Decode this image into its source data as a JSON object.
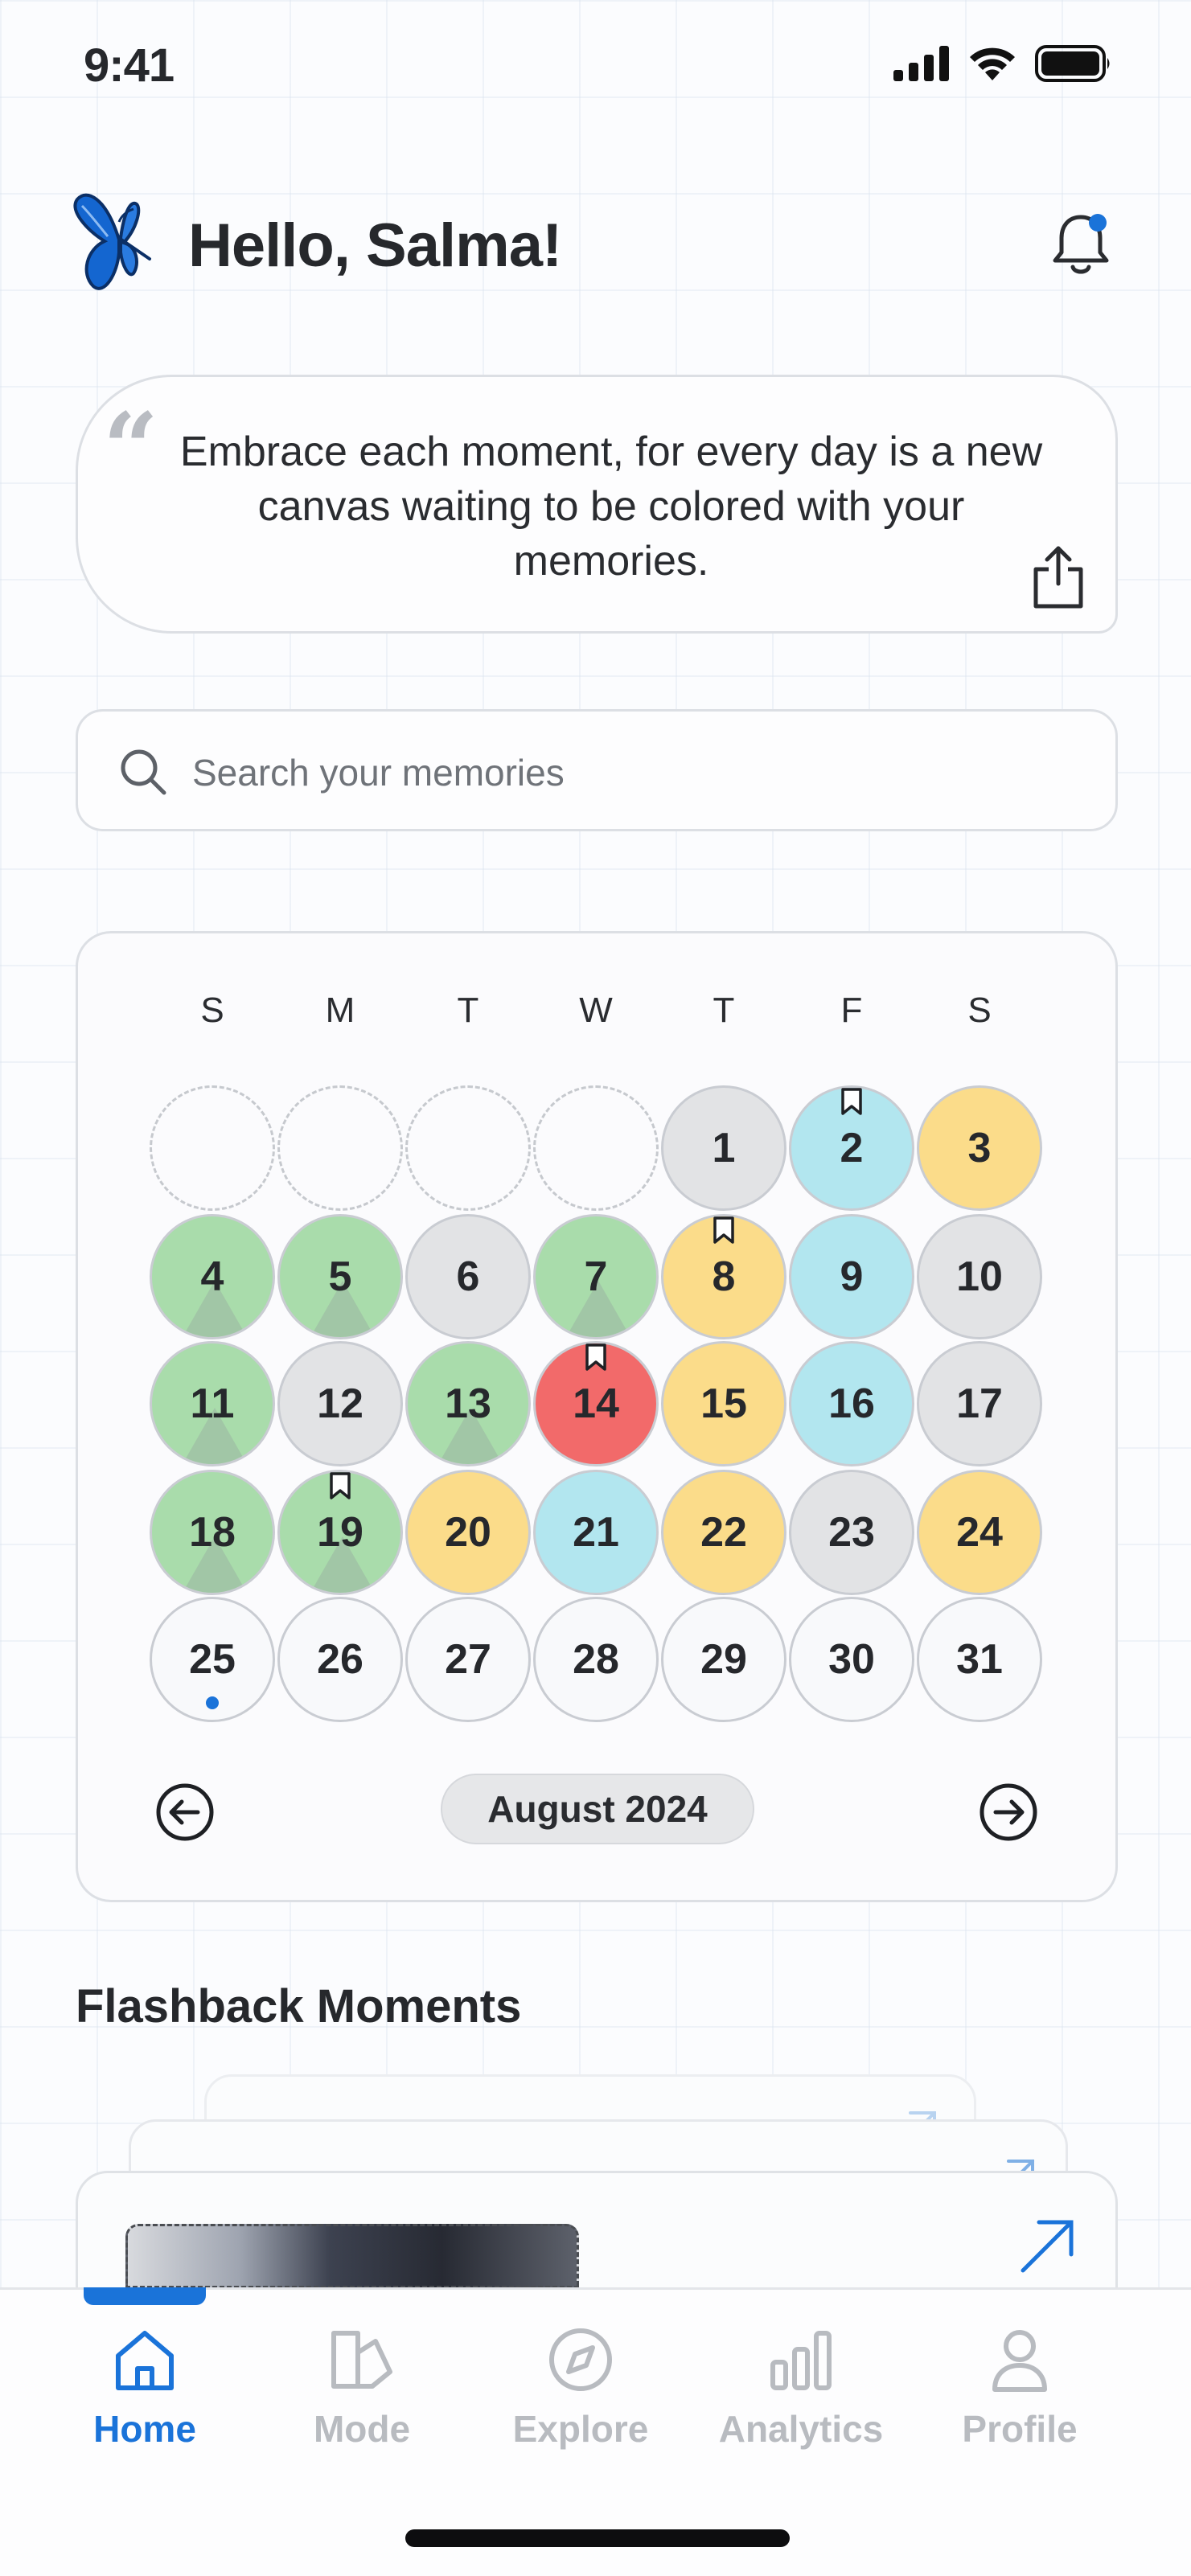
{
  "status_bar": {
    "time": "9:41"
  },
  "header": {
    "greeting": "Hello, Salma!"
  },
  "quote": {
    "text": "Embrace each moment, for every day is a new canvas waiting to be colored with your memories."
  },
  "search": {
    "placeholder": "Search your memories",
    "value": ""
  },
  "calendar": {
    "weekdays": [
      "S",
      "M",
      "T",
      "W",
      "T",
      "F",
      "S"
    ],
    "month_label": "August 2024",
    "days": [
      {
        "n": "1",
        "color": "gray"
      },
      {
        "n": "2",
        "color": "blue",
        "bookmark": true
      },
      {
        "n": "3",
        "color": "yellow"
      },
      {
        "n": "4",
        "color": "green"
      },
      {
        "n": "5",
        "color": "green"
      },
      {
        "n": "6",
        "color": "gray"
      },
      {
        "n": "7",
        "color": "green"
      },
      {
        "n": "8",
        "color": "yellow",
        "bookmark": true
      },
      {
        "n": "9",
        "color": "blue"
      },
      {
        "n": "10",
        "color": "gray"
      },
      {
        "n": "11",
        "color": "green"
      },
      {
        "n": "12",
        "color": "gray"
      },
      {
        "n": "13",
        "color": "green"
      },
      {
        "n": "14",
        "color": "red",
        "bookmark": true
      },
      {
        "n": "15",
        "color": "yellow"
      },
      {
        "n": "16",
        "color": "blue"
      },
      {
        "n": "17",
        "color": "gray"
      },
      {
        "n": "18",
        "color": "green"
      },
      {
        "n": "19",
        "color": "green",
        "bookmark": true
      },
      {
        "n": "20",
        "color": "yellow"
      },
      {
        "n": "21",
        "color": "blue"
      },
      {
        "n": "22",
        "color": "yellow"
      },
      {
        "n": "23",
        "color": "gray"
      },
      {
        "n": "24",
        "color": "yellow"
      },
      {
        "n": "25",
        "color": "none",
        "today": true
      },
      {
        "n": "26",
        "color": "none"
      },
      {
        "n": "27",
        "color": "none"
      },
      {
        "n": "28",
        "color": "none"
      },
      {
        "n": "29",
        "color": "none"
      },
      {
        "n": "30",
        "color": "none"
      },
      {
        "n": "31",
        "color": "none"
      }
    ]
  },
  "flashback": {
    "title": "Flashback Moments"
  },
  "tabs": [
    {
      "label": "Home",
      "icon": "home-icon",
      "active": true
    },
    {
      "label": "Mode",
      "icon": "mode-icon"
    },
    {
      "label": "Explore",
      "icon": "compass-icon"
    },
    {
      "label": "Analytics",
      "icon": "bar-chart-icon"
    },
    {
      "label": "Profile",
      "icon": "profile-icon"
    }
  ],
  "colors": {
    "accent": "#1a73d9",
    "gray": "#e2e3e5",
    "blue": "#b2e6ef",
    "yellow": "#fbdc8a",
    "green": "#a9dcab",
    "red": "#f26a6a"
  }
}
